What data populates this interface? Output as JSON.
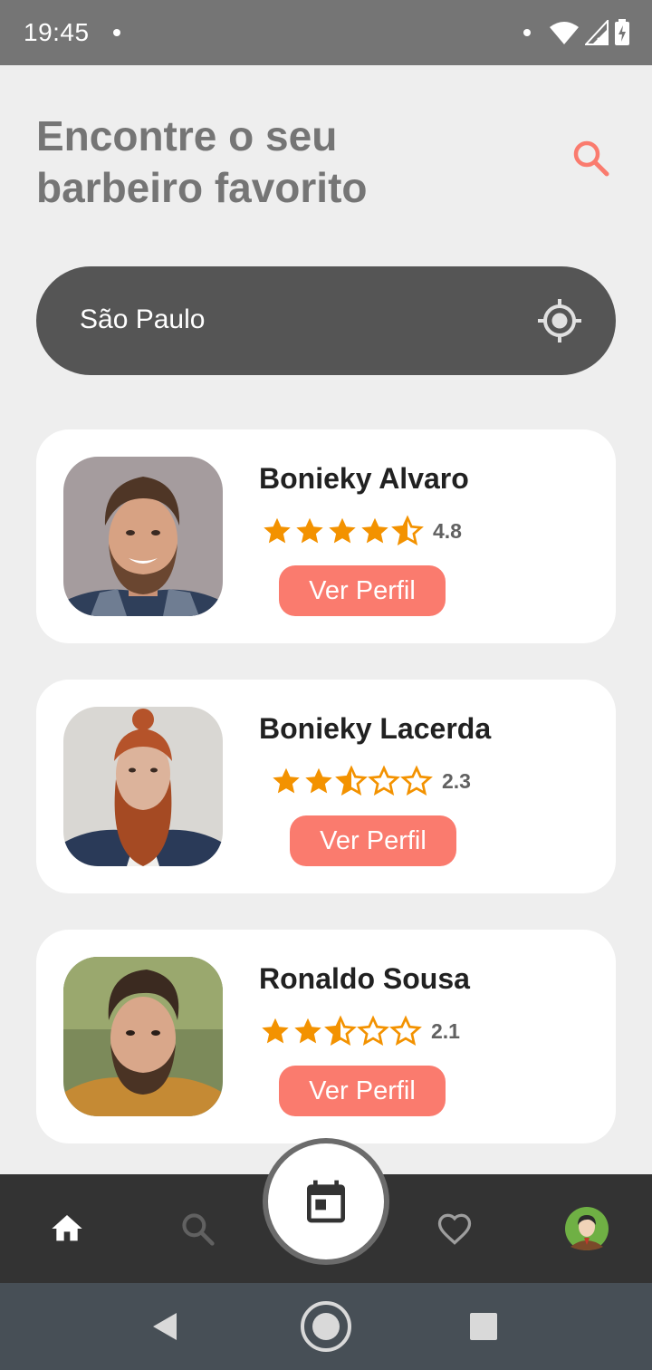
{
  "status_bar": {
    "time": "19:45",
    "icons": [
      "notification-dot-icon",
      "wifi-icon",
      "signal-icon",
      "battery-charging-icon"
    ]
  },
  "header": {
    "title": "Encontre o seu barbeiro favorito",
    "search_icon": "search-icon"
  },
  "location": {
    "city": "São Paulo",
    "icon": "gps-location-icon"
  },
  "colors": {
    "accent": "#fa7b6e",
    "star": "#f39200",
    "pill": "#555555",
    "nav_bg": "#333333"
  },
  "barbers": [
    {
      "name": "Bonieky Alvaro",
      "rating": "4.8",
      "button_label": "Ver Perfil"
    },
    {
      "name": "Bonieky Lacerda",
      "rating": "2.3",
      "button_label": "Ver Perfil"
    },
    {
      "name": "Ronaldo Sousa",
      "rating": "2.1",
      "button_label": "Ver Perfil"
    }
  ],
  "bottom_nav": {
    "items": [
      "home-icon",
      "search-icon",
      "calendar-icon",
      "heart-icon",
      "user-avatar"
    ],
    "active": "home-icon"
  },
  "system_nav": [
    "back-icon",
    "home-circle-icon",
    "recents-icon"
  ]
}
